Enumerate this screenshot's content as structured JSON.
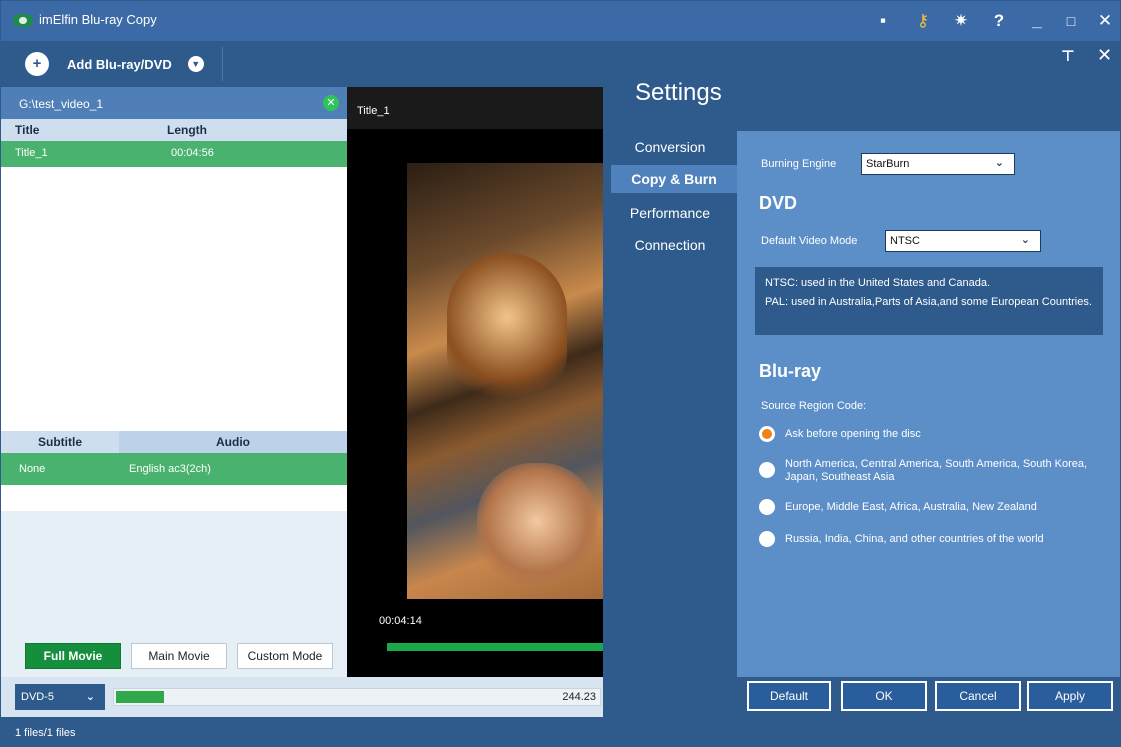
{
  "window": {
    "title": "imElfin Blu-ray Copy"
  },
  "titlebar_icons": [
    "feedback-icon",
    "key-icon",
    "gear-icon",
    "help-icon",
    "minimize-icon",
    "maximize-icon",
    "close-icon"
  ],
  "toolbar": {
    "add_label": "Add Blu-ray/DVD"
  },
  "source": {
    "path": "G:\\test_video_1",
    "list_headers": {
      "title": "Title",
      "length": "Length"
    },
    "selected_row": {
      "title": "Title_1",
      "length": "00:04:56"
    },
    "sa_headers": {
      "subtitle": "Subtitle",
      "audio": "Audio"
    },
    "sa_row": {
      "subtitle": "None",
      "audio": "English ac3(2ch)"
    },
    "modes": [
      "Full Movie",
      "Main Movie",
      "Custom Mode"
    ],
    "active_mode": "Full Movie"
  },
  "player": {
    "tab": "Title_1",
    "timestamp": "00:04:14",
    "progress_fraction": 0.86
  },
  "output": {
    "disc_type": "DVD-5",
    "capacity_text": "244.23",
    "capacity_fraction": 0.1
  },
  "settings": {
    "title": "Settings",
    "nav": [
      "Conversion",
      "Copy & Burn",
      "Performance",
      "Connection"
    ],
    "active_nav": "Copy & Burn",
    "burning_engine_label": "Burning Engine",
    "burning_engine_value": "StarBurn",
    "dvd_heading": "DVD",
    "video_mode_label": "Default Video Mode",
    "video_mode_value": "NTSC",
    "info_ntsc": "NTSC: used in the United States and Canada.",
    "info_pal": "PAL: used in Australia,Parts of Asia,and some European Countries.",
    "bluray_heading": "Blu-ray",
    "region_label": "Source Region Code:",
    "regions": [
      "Ask before opening the disc",
      "North America, Central America, South America, South Korea, Japan, Southeast Asia",
      "Europe, Middle East, Africa, Australia, New Zealand",
      "Russia, India, China, and other countries of the world"
    ],
    "selected_region": 0,
    "buttons": [
      "Default",
      "OK",
      "Cancel",
      "Apply"
    ]
  },
  "status": {
    "files": "1 files/1 files"
  },
  "colors": {
    "accent_green": "#49b26e",
    "primary_blue": "#2e5a8c",
    "panel_blue": "#5c8fc8",
    "radio_orange": "#f0801c"
  }
}
